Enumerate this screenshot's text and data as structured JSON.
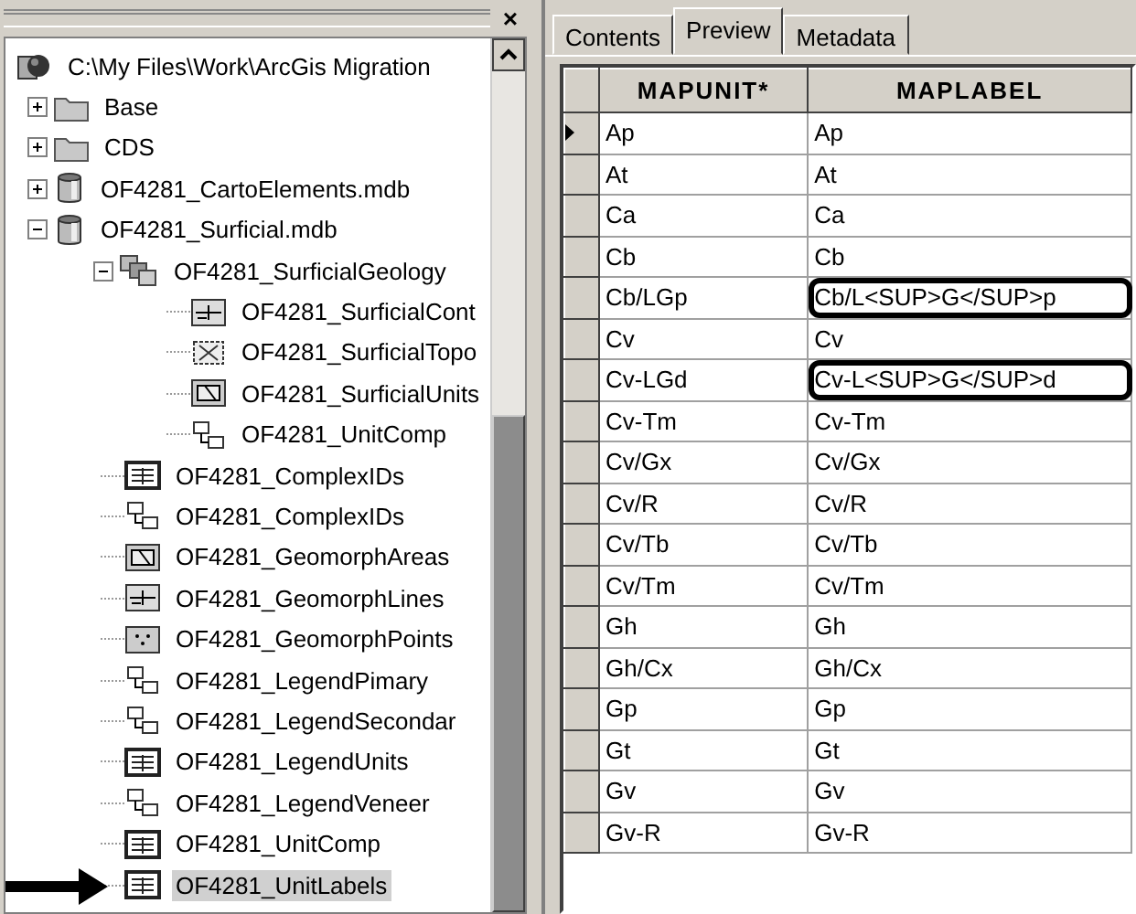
{
  "catalog_tree": {
    "close_glyph": "×",
    "root": {
      "label": "C:\\My Files\\Work\\ArcGis Migration",
      "kind": "root",
      "children": [
        {
          "label": "Base",
          "kind": "folder",
          "expanded": false
        },
        {
          "label": "CDS",
          "kind": "folder",
          "expanded": false
        },
        {
          "label": "OF4281_CartoElements.mdb",
          "kind": "database",
          "expanded": false
        },
        {
          "label": "OF4281_Surficial.mdb",
          "kind": "database",
          "expanded": true,
          "children": [
            {
              "label": "OF4281_SurficialGeology",
              "kind": "dataset",
              "expanded": true,
              "children": [
                {
                  "label": "OF4281_SurficialCont",
                  "kind": "line"
                },
                {
                  "label": "OF4281_SurficialTopo",
                  "kind": "topology"
                },
                {
                  "label": "OF4281_SurficialUnits",
                  "kind": "polygon"
                },
                {
                  "label": "OF4281_UnitComp",
                  "kind": "relationship"
                }
              ]
            },
            {
              "label": "OF4281_ComplexIDs",
              "kind": "table"
            },
            {
              "label": "OF4281_ComplexIDs",
              "kind": "relationship"
            },
            {
              "label": "OF4281_GeomorphAreas",
              "kind": "polygon"
            },
            {
              "label": "OF4281_GeomorphLines",
              "kind": "line"
            },
            {
              "label": "OF4281_GeomorphPoints",
              "kind": "point"
            },
            {
              "label": "OF4281_LegendPimary",
              "kind": "relationship"
            },
            {
              "label": "OF4281_LegendSecondar",
              "kind": "relationship"
            },
            {
              "label": "OF4281_LegendUnits",
              "kind": "table"
            },
            {
              "label": "OF4281_LegendVeneer",
              "kind": "relationship"
            },
            {
              "label": "OF4281_UnitComp",
              "kind": "table"
            },
            {
              "label": "OF4281_UnitLabels",
              "kind": "table",
              "selected": true,
              "arrow": true
            }
          ]
        }
      ]
    }
  },
  "tabs": [
    {
      "label": "Contents",
      "selected": false
    },
    {
      "label": "Preview",
      "selected": true
    },
    {
      "label": "Metadata",
      "selected": false
    }
  ],
  "table": {
    "columns": [
      "MAPUNIT*",
      "MAPLABEL"
    ],
    "rows": [
      {
        "cells": [
          "Ap",
          "Ap"
        ],
        "current": true,
        "circled": false
      },
      {
        "cells": [
          "At",
          "At"
        ],
        "current": false,
        "circled": false
      },
      {
        "cells": [
          "Ca",
          "Ca"
        ],
        "current": false,
        "circled": false
      },
      {
        "cells": [
          "Cb",
          "Cb"
        ],
        "current": false,
        "circled": false
      },
      {
        "cells": [
          "Cb/LGp",
          "Cb/L<SUP>G</SUP>p"
        ],
        "current": false,
        "circled": true
      },
      {
        "cells": [
          "Cv",
          "Cv"
        ],
        "current": false,
        "circled": false
      },
      {
        "cells": [
          "Cv-LGd",
          "Cv-L<SUP>G</SUP>d"
        ],
        "current": false,
        "circled": true
      },
      {
        "cells": [
          "Cv-Tm",
          "Cv-Tm"
        ],
        "current": false,
        "circled": false
      },
      {
        "cells": [
          "Cv/Gx",
          "Cv/Gx"
        ],
        "current": false,
        "circled": false
      },
      {
        "cells": [
          "Cv/R",
          "Cv/R"
        ],
        "current": false,
        "circled": false
      },
      {
        "cells": [
          "Cv/Tb",
          "Cv/Tb"
        ],
        "current": false,
        "circled": false
      },
      {
        "cells": [
          "Cv/Tm",
          "Cv/Tm"
        ],
        "current": false,
        "circled": false
      },
      {
        "cells": [
          "Gh",
          "Gh"
        ],
        "current": false,
        "circled": false
      },
      {
        "cells": [
          "Gh/Cx",
          "Gh/Cx"
        ],
        "current": false,
        "circled": false
      },
      {
        "cells": [
          "Gp",
          "Gp"
        ],
        "current": false,
        "circled": false
      },
      {
        "cells": [
          "Gt",
          "Gt"
        ],
        "current": false,
        "circled": false
      },
      {
        "cells": [
          "Gv",
          "Gv"
        ],
        "current": false,
        "circled": false
      },
      {
        "cells": [
          "Gv-R",
          "Gv-R"
        ],
        "current": false,
        "circled": false
      }
    ]
  }
}
